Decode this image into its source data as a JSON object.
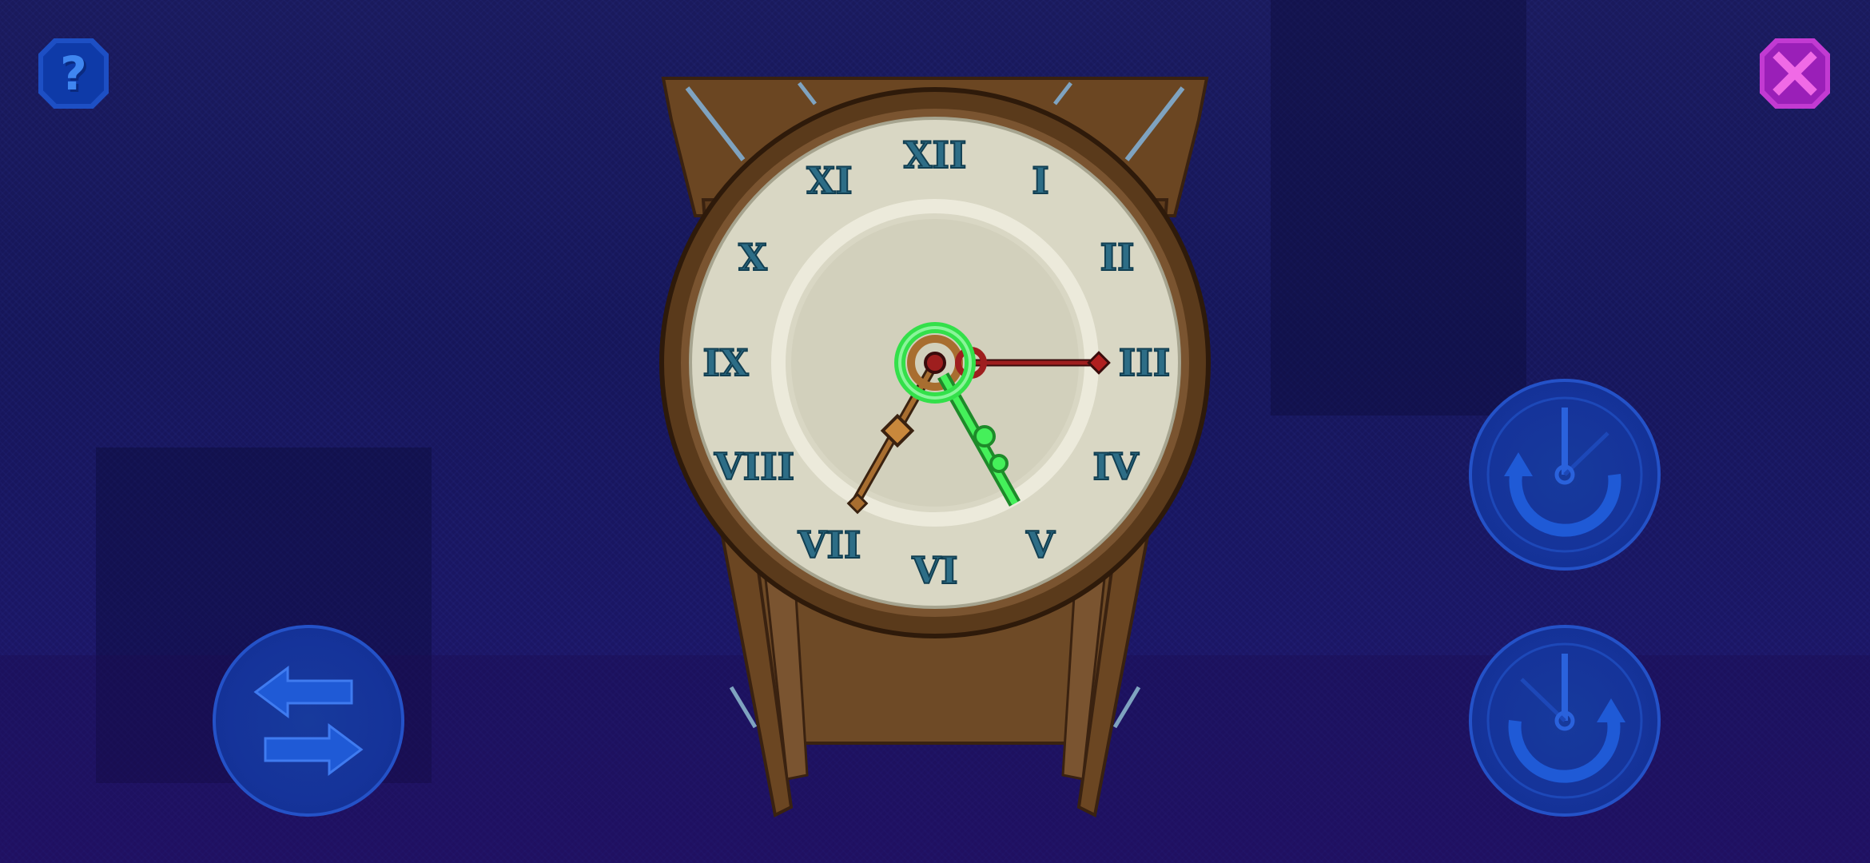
{
  "colors": {
    "background": "#181860",
    "help_button": "#1d4fc4",
    "close_button": "#c23ad2",
    "control_button": "#15339a",
    "clock_wood": "#6e4a26",
    "clock_face": "#d9d7c4",
    "numerals": "#2d6d86",
    "hour_hand_highlight": "#33e04a",
    "minute_hand": "#8b1a1a",
    "second_hand": "#8b5a24"
  },
  "icons": {
    "help": "question-mark-icon",
    "close": "close-x-icon",
    "swap": "swap-arrows-icon",
    "rotate_ccw": "rotate-counterclockwise-icon",
    "rotate_cw": "rotate-clockwise-icon"
  },
  "help_button": {
    "label": "?"
  },
  "clock": {
    "numerals": [
      "XII",
      "I",
      "II",
      "III",
      "IV",
      "V",
      "VI",
      "VII",
      "VIII",
      "IX",
      "X",
      "XI"
    ],
    "hands": [
      {
        "name": "selected-hand",
        "color": "#33e04a",
        "points_at": "V"
      },
      {
        "name": "red-hand",
        "color": "#8b1a1a",
        "points_at": "III"
      },
      {
        "name": "bronze-hand",
        "color": "#8b5a24",
        "points_at": "VII"
      }
    ]
  }
}
